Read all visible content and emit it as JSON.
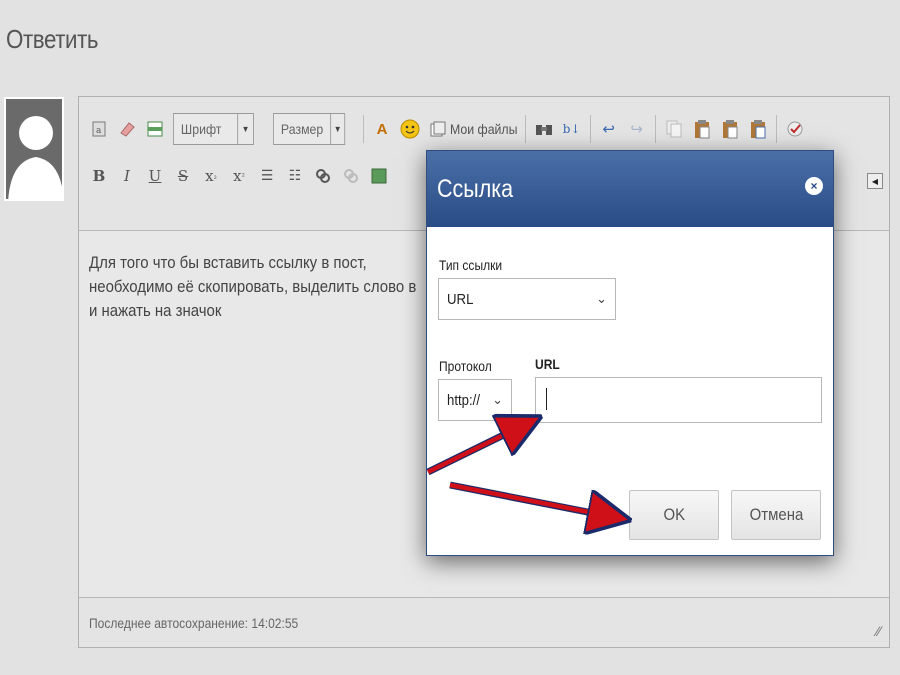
{
  "page": {
    "title": "Ответить"
  },
  "editor": {
    "toolbar": {
      "font_select": "Шрифт",
      "size_select": "Размер",
      "my_files_label": "Мои файлы",
      "bold_label": "B",
      "italic_label": "I",
      "underline_label": "U",
      "strike_label": "S",
      "subscript_label": "x",
      "superscript_label": "x"
    },
    "content_lines": [
      "Для того что бы вставить ссылку в пост,",
      "необходимо её скопировать, выделить слово в",
      "и нажать на значок"
    ],
    "autosave_status": "Последнее автосохранение: 14:02:55"
  },
  "dialog": {
    "title": "Ссылка",
    "link_type_label": "Тип ссылки",
    "link_type_value": "URL",
    "protocol_label": "Протокол",
    "protocol_value": "http://",
    "url_label": "URL",
    "url_value": "",
    "ok_label": "OK",
    "cancel_label": "Отмена"
  },
  "colors": {
    "dialog_header": "#2a4c86",
    "arrow": "#d01018"
  }
}
